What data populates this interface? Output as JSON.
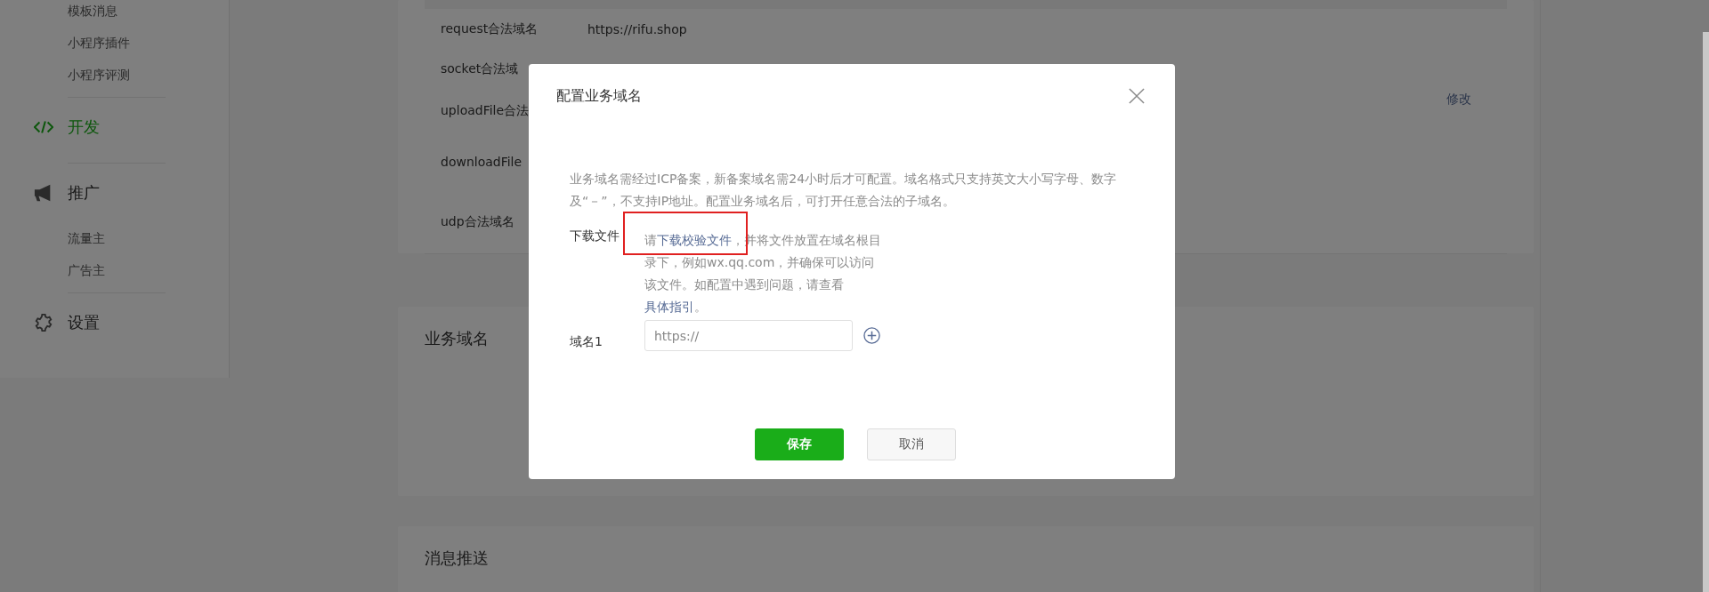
{
  "sidebar": {
    "groups": [
      {
        "children": [
          {
            "label": "模板消息",
            "selected": false
          },
          {
            "label": "小程序插件",
            "selected": false
          },
          {
            "label": "小程序评测",
            "selected": false
          }
        ]
      },
      {
        "label": "开发",
        "selected": true
      },
      {
        "label": "推广",
        "selected": false,
        "children": [
          {
            "label": "流量主",
            "selected": false
          },
          {
            "label": "广告主",
            "selected": false
          }
        ]
      },
      {
        "label": "设置",
        "selected": false
      }
    ]
  },
  "server_domains": {
    "rows": [
      {
        "label": "request合法域名",
        "value": "https://rifu.shop"
      },
      {
        "label": "socket合法域"
      },
      {
        "label": "uploadFile合法"
      },
      {
        "label": "downloadFile"
      },
      {
        "label": "udp合法域名"
      }
    ],
    "edit_link": "修改"
  },
  "sections": [
    {
      "title": "业务域名"
    },
    {
      "title": "消息推送"
    }
  ],
  "dialog": {
    "title": "配置业务域名",
    "description": "业务域名需经过ICP备案，新备案域名需24小时后才可配置。域名格式只支持英文大小写字母、数字及“－”，不支持IP地址。配置业务域名后，可打开任意合法的子域名。",
    "download_label": "下载文件",
    "instruction": [
      {
        "kind": "text",
        "text": "请"
      },
      {
        "kind": "link",
        "text": "下载校验文件"
      },
      {
        "kind": "text",
        "text": "，并将文件放置在域名根目录下，例如wx.qq.com，并确保可以访问该文件。如配置中遇到问题，请查看"
      },
      {
        "kind": "link",
        "text": "具体指引"
      },
      {
        "kind": "text",
        "text": "。"
      }
    ],
    "domain_label": "域名1",
    "domain_placeholder": "https://",
    "buttons": [
      {
        "kind": "primary",
        "label": "保存"
      },
      {
        "kind": "default",
        "label": "取消"
      }
    ]
  }
}
